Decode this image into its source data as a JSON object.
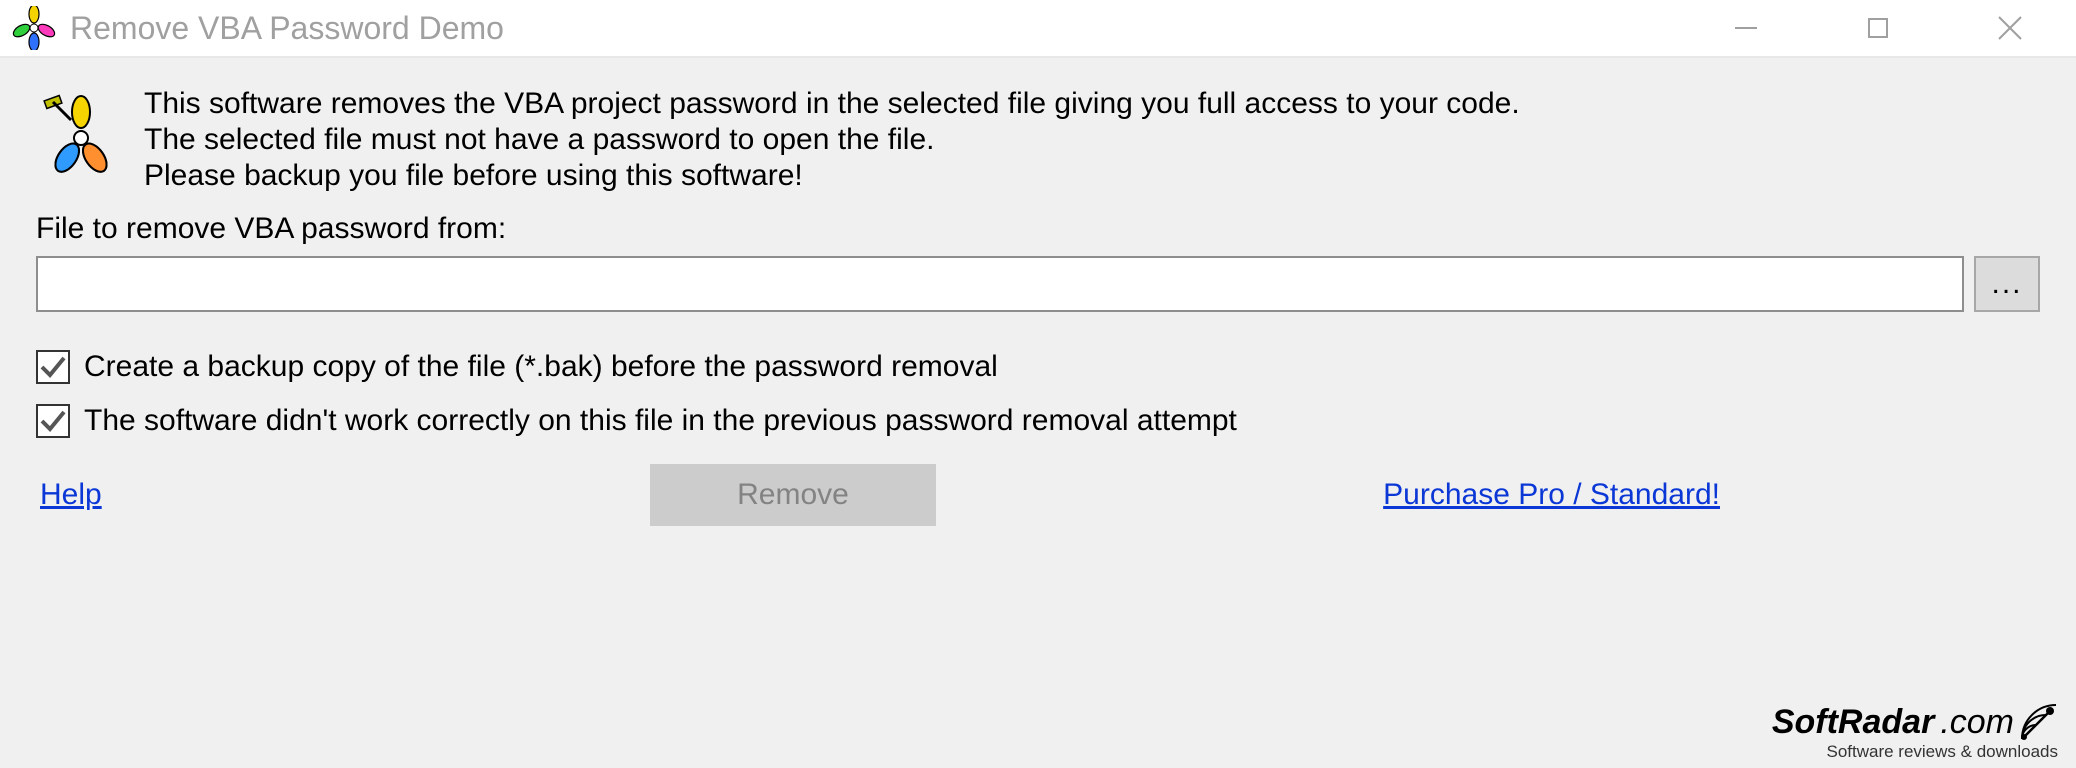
{
  "window": {
    "title": "Remove VBA Password Demo"
  },
  "intro": {
    "line1": "This software removes the VBA project password in the selected file giving you full access to your code.",
    "line2": "The selected file must not have a password to open the file.",
    "line3": "Please backup you file before using this software!"
  },
  "file": {
    "label": "File to remove VBA password from:",
    "value": "",
    "browse_label": "..."
  },
  "checks": {
    "backup": {
      "label": "Create a backup copy of the file (*.bak) before the password removal",
      "checked": true
    },
    "retry": {
      "label": "The software didn't work correctly on this file in the previous password removal attempt",
      "checked": true
    }
  },
  "actions": {
    "help": "Help",
    "remove": "Remove",
    "purchase": "Purchase Pro / Standard!"
  },
  "watermark": {
    "brand_bold": "SoftRadar",
    "brand_light": ".com",
    "tagline": "Software reviews & downloads"
  }
}
